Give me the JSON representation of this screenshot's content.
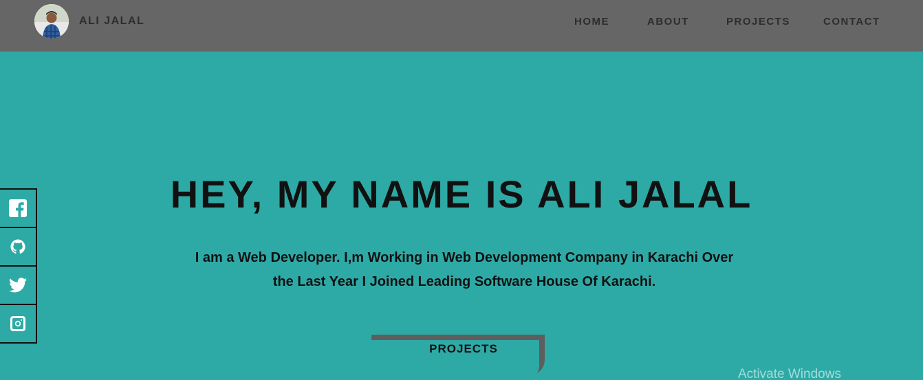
{
  "header": {
    "brand": "ALI JALAL",
    "nav": [
      {
        "label": "HOME"
      },
      {
        "label": "ABOUT"
      },
      {
        "label": "PROJECTS"
      },
      {
        "label": "CONTACT"
      }
    ]
  },
  "social": [
    "facebook-icon",
    "github-icon",
    "twitter-icon",
    "instagram-icon"
  ],
  "hero": {
    "title": "HEY, MY NAME IS ALI JALAL",
    "description": "I am a Web Developer. I,m Working in Web Development Company in Karachi Over the Last Year I Joined Leading Software House Of Karachi.",
    "button": "PROJECTS"
  },
  "watermark": "Activate Windows",
  "colors": {
    "header_bg": "#666666",
    "page_bg": "#2eaaa6",
    "text": "#111111",
    "nav_text": "#2d2d2d",
    "button_shadow": "#5e5e5e"
  }
}
